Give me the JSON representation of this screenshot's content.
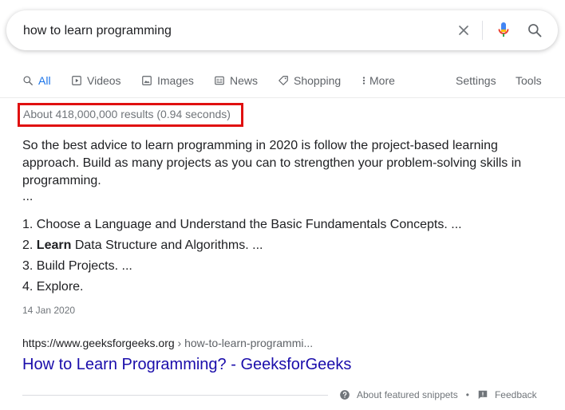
{
  "search": {
    "query": "how to learn programming",
    "icons": {
      "clear": "close-icon",
      "mic": "microphone-icon",
      "search": "search-icon"
    },
    "mic_colors": [
      "#4285f4",
      "#ea4335",
      "#fbbc04",
      "#34a853"
    ]
  },
  "tabs": {
    "items": [
      {
        "label": "All",
        "icon": "search-icon",
        "active": true
      },
      {
        "label": "Videos",
        "icon": "video-icon"
      },
      {
        "label": "Images",
        "icon": "image-icon"
      },
      {
        "label": "News",
        "icon": "news-icon"
      },
      {
        "label": "Shopping",
        "icon": "tag-icon"
      },
      {
        "label": "More",
        "icon": "more-vert-icon"
      }
    ],
    "settings": "Settings",
    "tools": "Tools"
  },
  "stats": {
    "text": "About 418,000,000 results (0.94 seconds)",
    "highlight_color": "#e01010"
  },
  "snippet": {
    "text": "So the best advice to learn programming in 2020 is follow the project-based learning approach. Build as many projects as you can to strengthen your problem-solving skills in programming.",
    "ellipsis": "...",
    "steps": [
      {
        "number": "1.",
        "bold": "",
        "text": "Choose a Language and Understand the Basic Fundamentals Concepts. ..."
      },
      {
        "number": "2.",
        "bold": "Learn",
        "text": " Data Structure and Algorithms. ..."
      },
      {
        "number": "3.",
        "bold": "",
        "text": "Build Projects. ..."
      },
      {
        "number": "4.",
        "bold": "",
        "text": "Explore."
      }
    ],
    "date": "14 Jan 2020"
  },
  "result": {
    "url": "https://www.geeksforgeeks.org",
    "breadcrumb": " › how-to-learn-programmi...",
    "title": "How to Learn Programming? - GeeksforGeeks",
    "title_color": "#1a0dab"
  },
  "footer": {
    "about": "About featured snippets",
    "separator": "•",
    "feedback": "Feedback"
  }
}
